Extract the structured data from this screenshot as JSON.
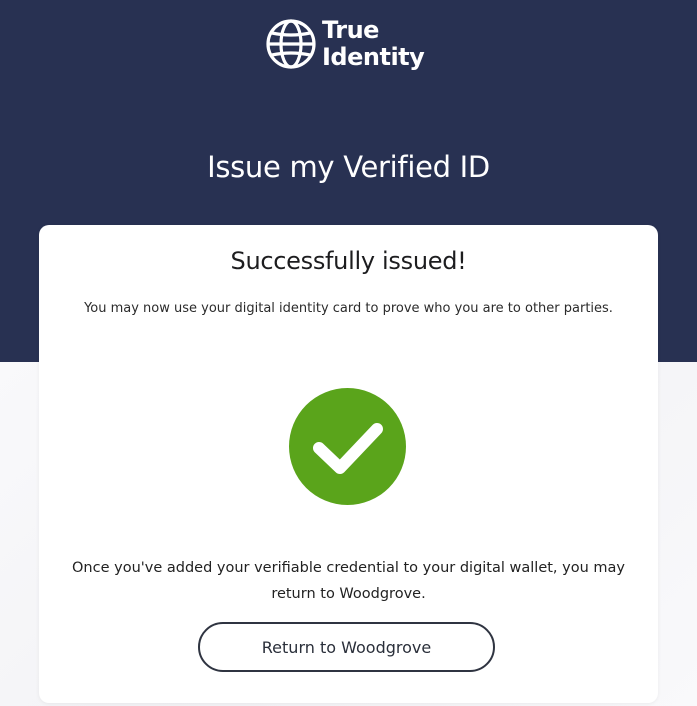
{
  "brand": {
    "name_line1": "True",
    "name_line2": "Identity",
    "logo_icon": "globe-icon"
  },
  "header": {
    "title": "Issue my Verified ID"
  },
  "card": {
    "heading": "Successfully issued!",
    "description": "You may now use your digital identity card to prove who you are to other parties.",
    "status_icon": "check-circle-icon",
    "followup": "Once you've added your verifiable credential to your digital wallet, you may return to Woodgrove.",
    "button_label": "Return to Woodgrove"
  },
  "colors": {
    "header_bg": "#283152",
    "success_green": "#5aa41b",
    "card_bg": "#ffffff"
  }
}
